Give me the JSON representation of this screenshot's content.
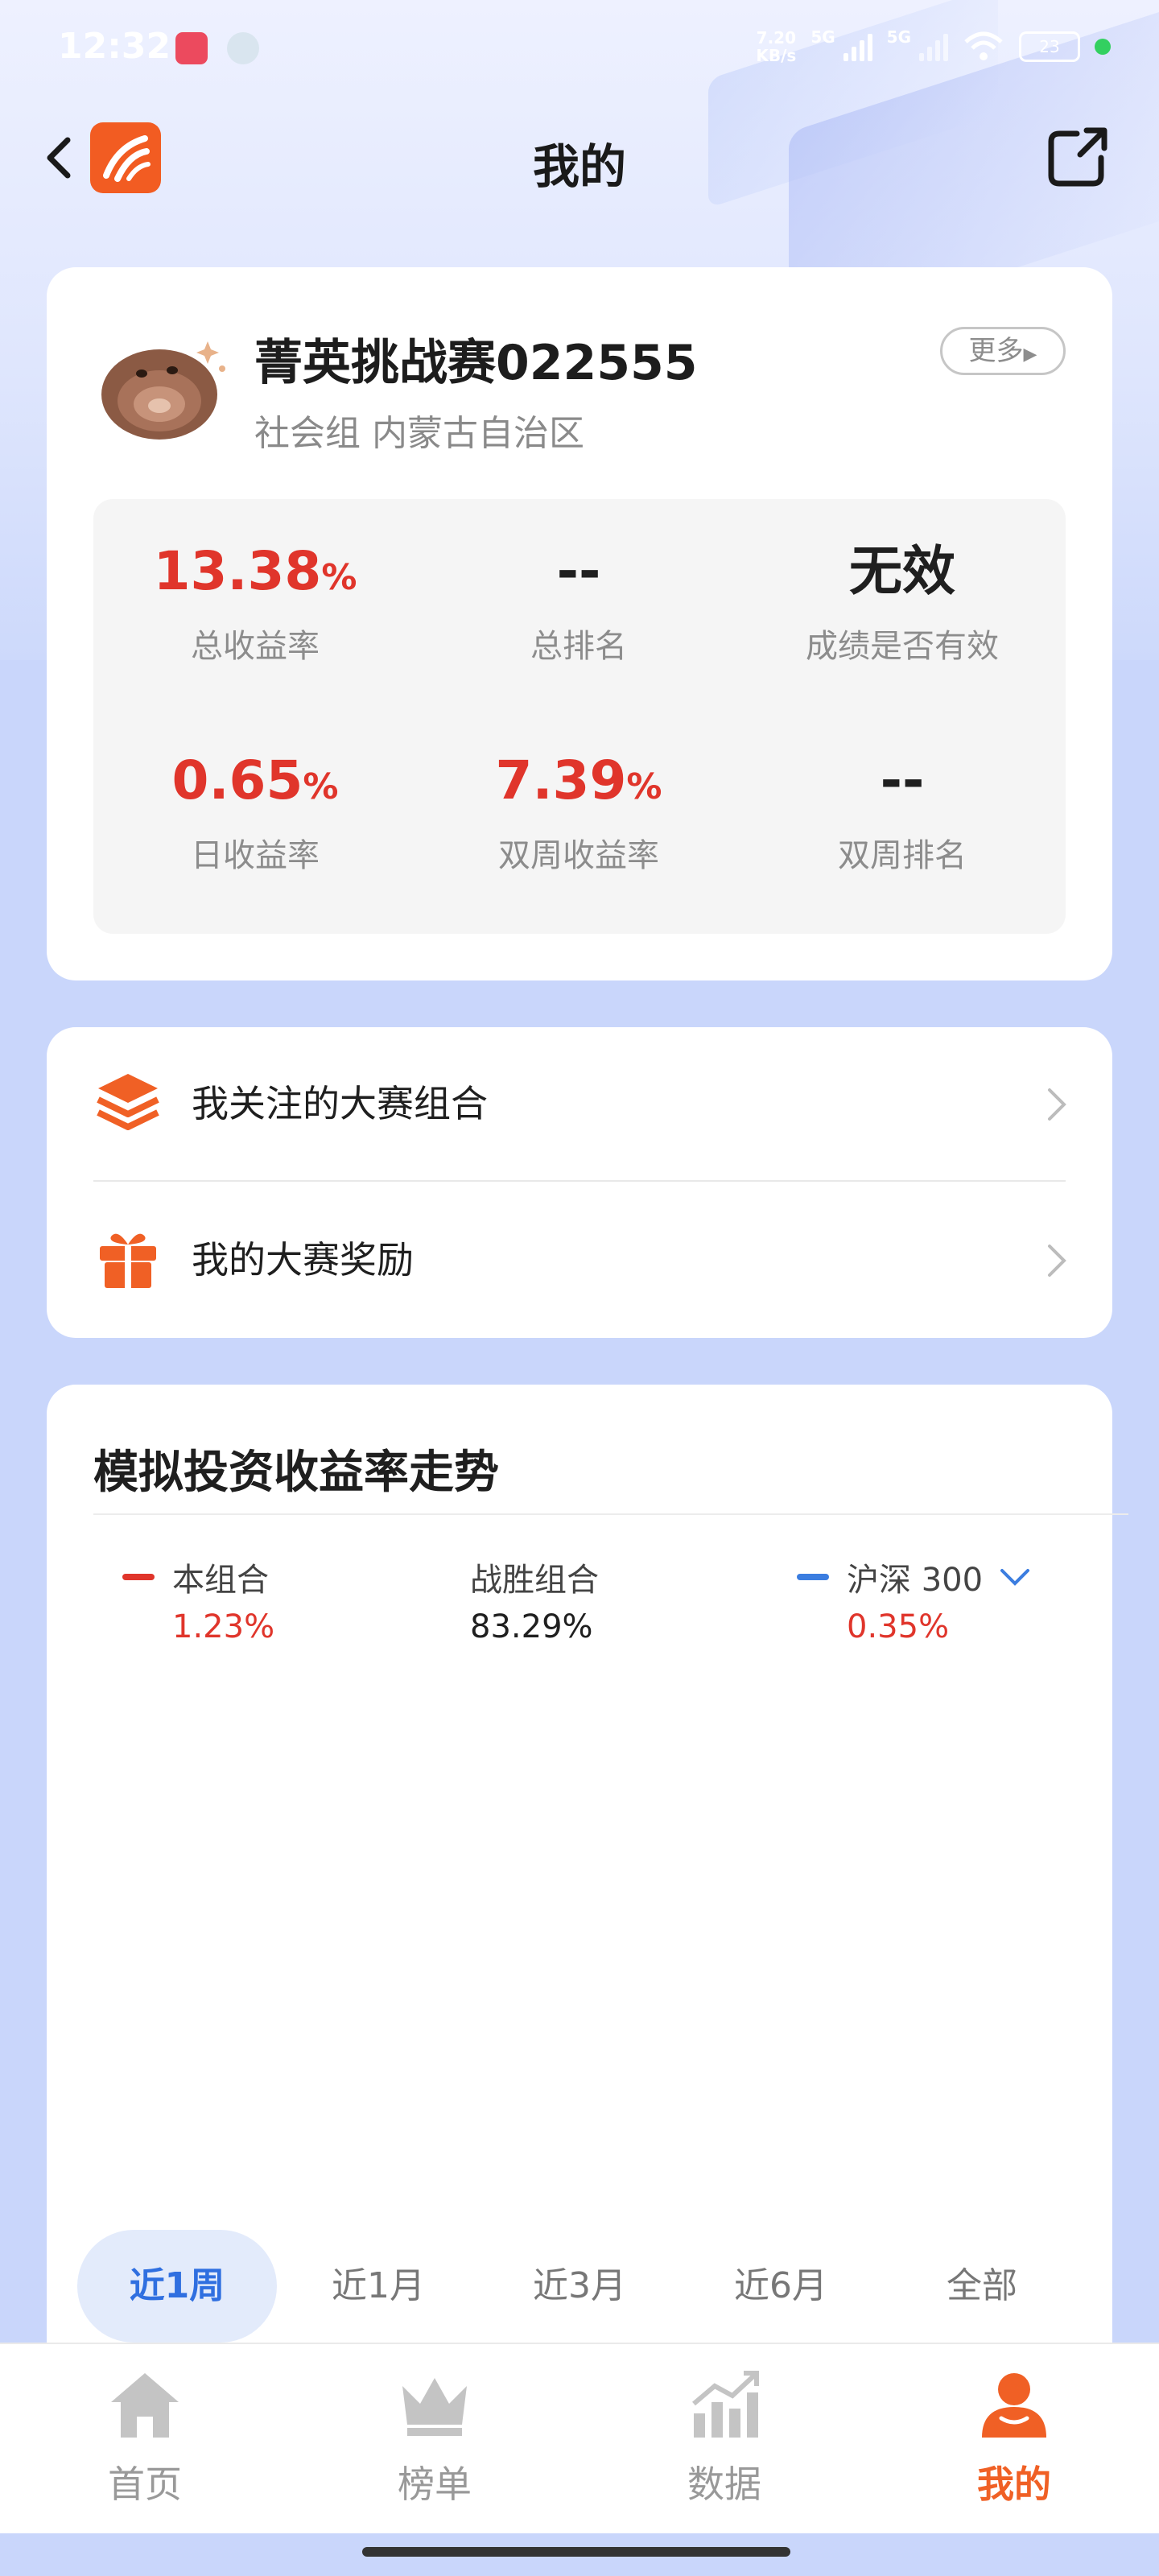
{
  "status_bar": {
    "time": "12:32",
    "net_speed_value": "7.20",
    "net_speed_unit": "KB/s",
    "sim1": "5G",
    "sim2": "5G",
    "battery": "23"
  },
  "header": {
    "title": "我的"
  },
  "profile": {
    "name": "菁英挑战赛022555",
    "group": "社会组 内蒙古自治区",
    "more_label": "更多"
  },
  "stats": [
    {
      "value": "13.38",
      "unit": "%",
      "label": "总收益率",
      "color": "#e0352b"
    },
    {
      "value": "--",
      "unit": "",
      "label": "总排名",
      "color": "#1f1f1f"
    },
    {
      "value": "无效",
      "unit": "",
      "label": "成绩是否有效",
      "color": "#1f1f1f"
    },
    {
      "value": "0.65",
      "unit": "%",
      "label": "日收益率",
      "color": "#e0352b"
    },
    {
      "value": "7.39",
      "unit": "%",
      "label": "双周收益率",
      "color": "#e0352b"
    },
    {
      "value": "--",
      "unit": "",
      "label": "双周排名",
      "color": "#1f1f1f"
    }
  ],
  "links": [
    {
      "label": "我关注的大赛组合",
      "icon": "layers-icon"
    },
    {
      "label": "我的大赛奖励",
      "icon": "gift-icon"
    }
  ],
  "chart": {
    "title": "模拟投资收益率走势",
    "legend": [
      {
        "name": "本组合",
        "value": "1.23%",
        "line_color": "#e0352b",
        "value_color": "#e0352b"
      },
      {
        "name": "战胜组合",
        "value": "83.29%",
        "line_color": "",
        "value_color": "#1f1f1f"
      },
      {
        "name": "沪深 300",
        "value": "0.35%",
        "line_color": "#3b7de0",
        "value_color": "#e0352b"
      }
    ],
    "ranges": [
      "近1周",
      "近1月",
      "近3月",
      "近6月",
      "全部"
    ],
    "active_range": "近1周"
  },
  "bottom_nav": [
    {
      "label": "首页",
      "icon": "home-icon",
      "active": false
    },
    {
      "label": "榜单",
      "icon": "crown-icon",
      "active": false
    },
    {
      "label": "数据",
      "icon": "chart-icon",
      "active": false
    },
    {
      "label": "我的",
      "icon": "user-icon",
      "active": true
    }
  ],
  "colors": {
    "accent": "#f06025",
    "positive": "#e0352b",
    "blue": "#3b7de0"
  }
}
